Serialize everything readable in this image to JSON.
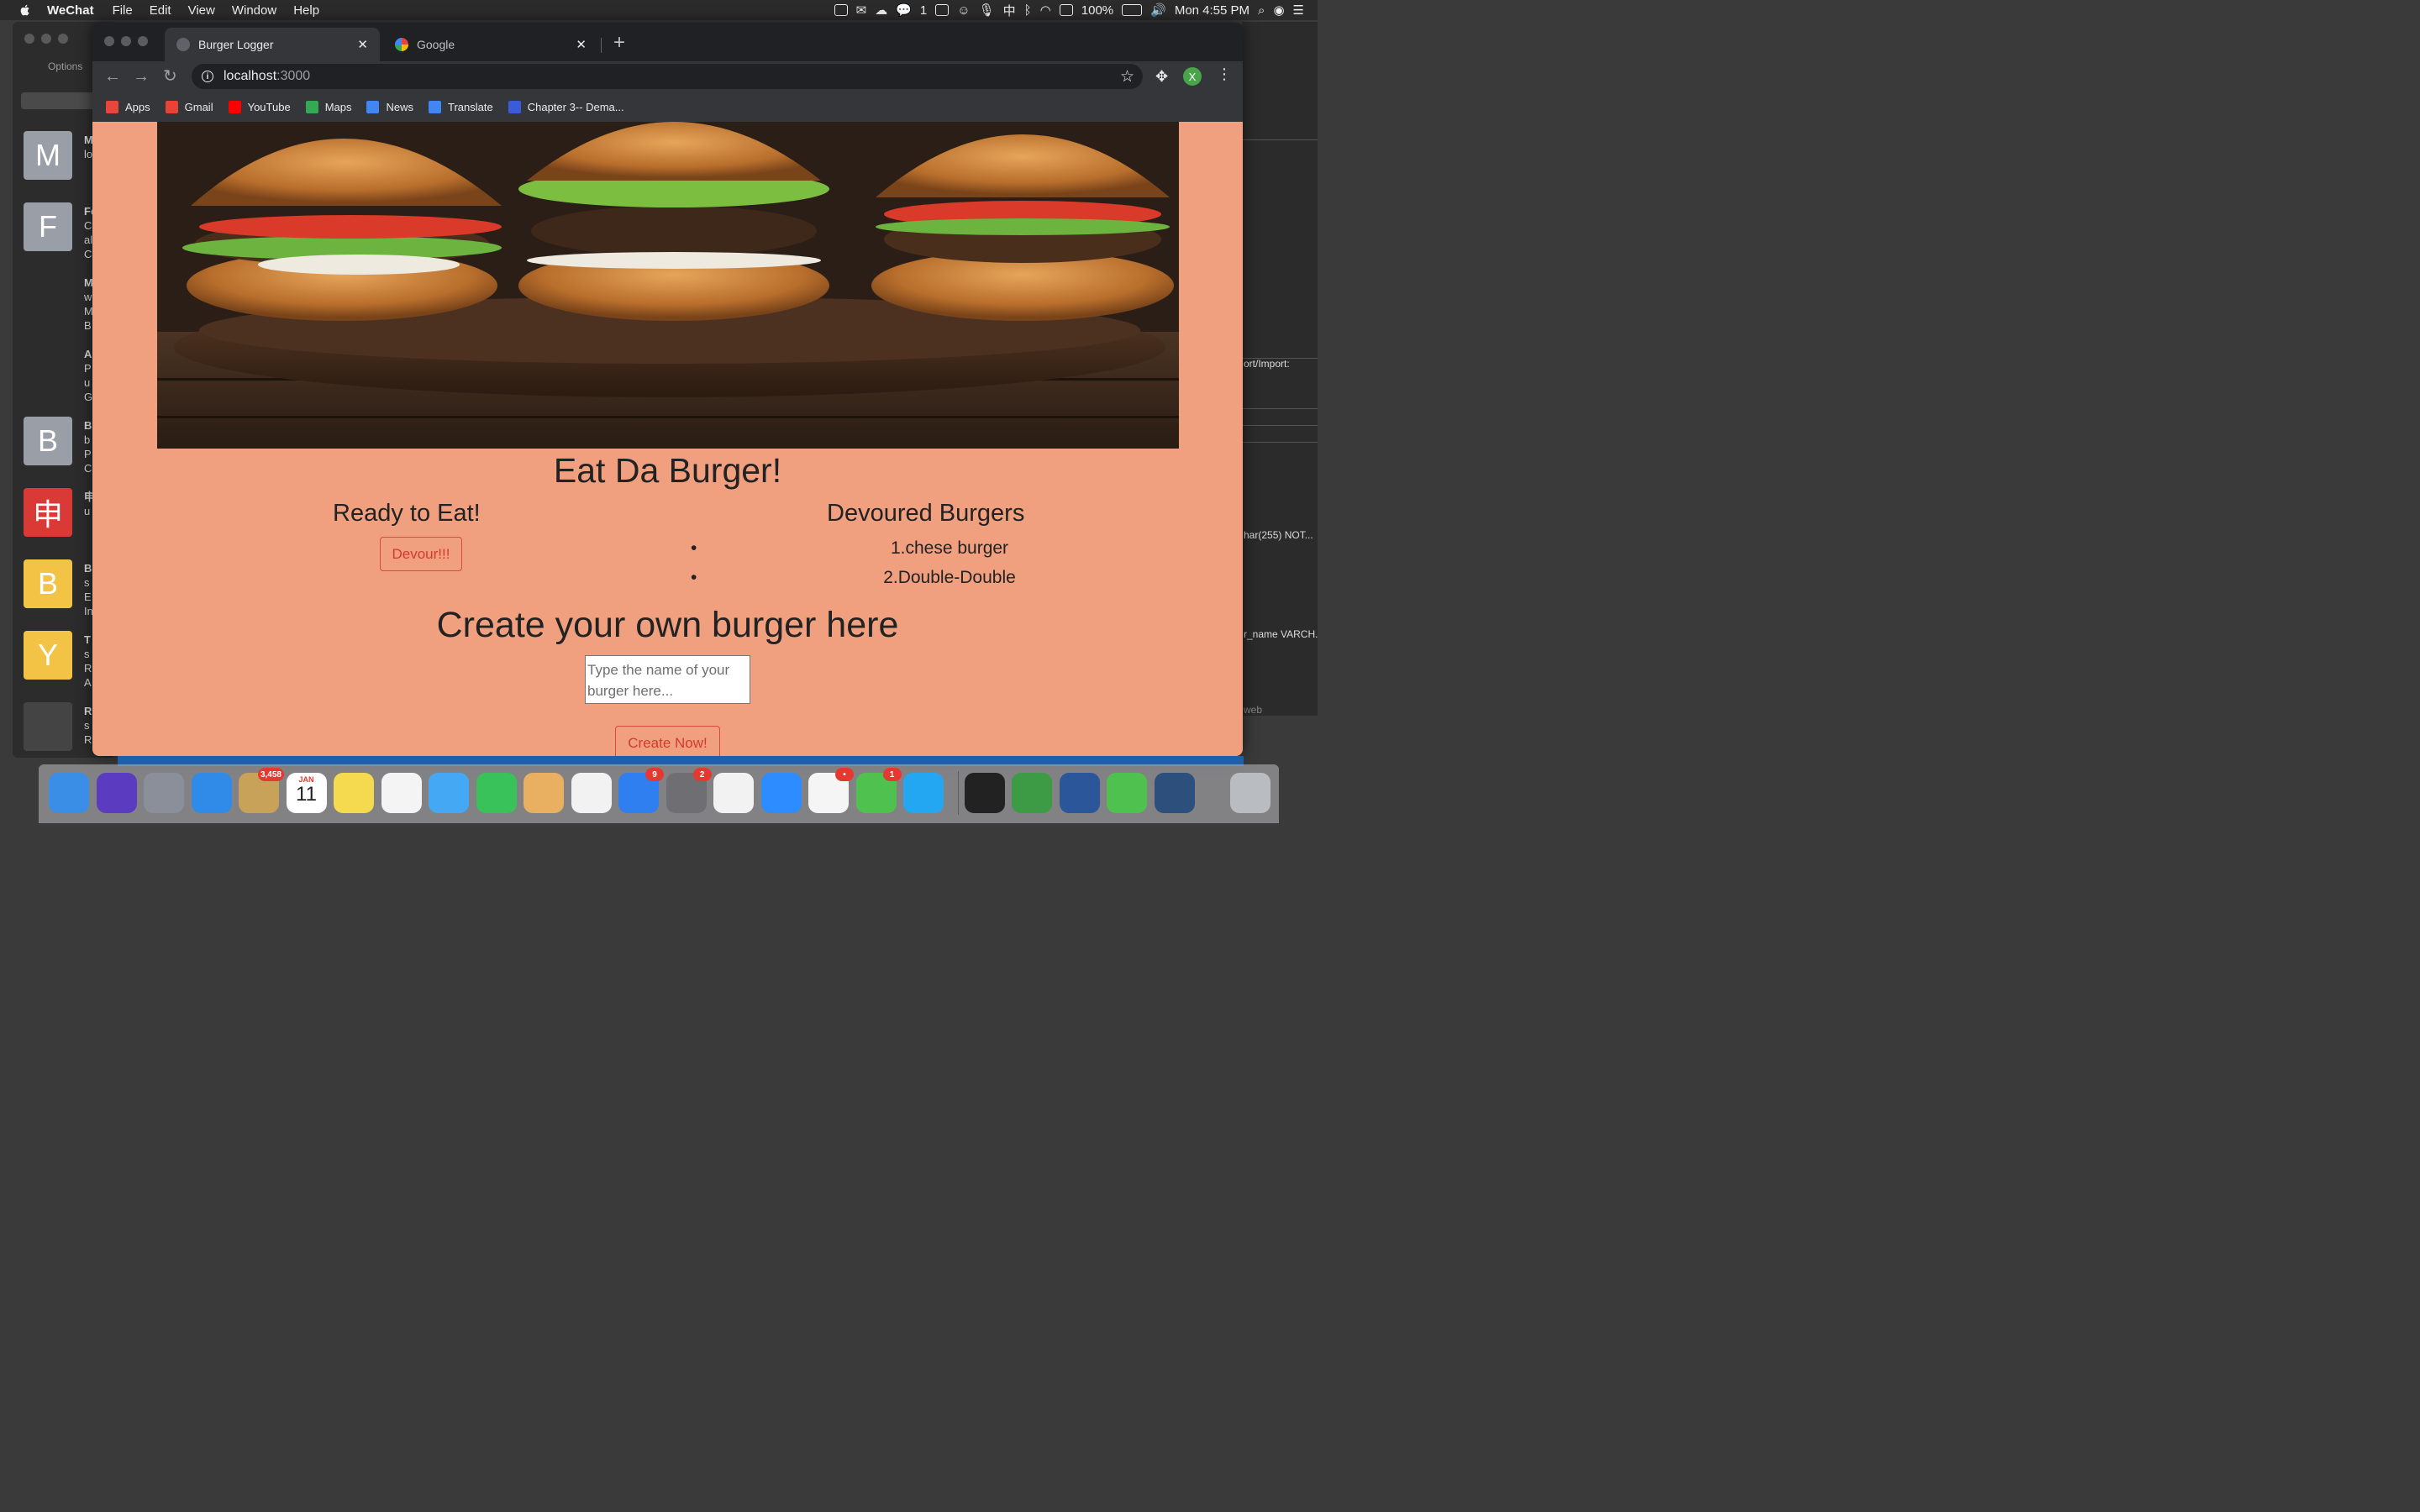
{
  "menubar": {
    "app_name": "WeChat",
    "menus": [
      "File",
      "Edit",
      "View",
      "Window",
      "Help"
    ],
    "wechat_count": "1",
    "battery": "100%",
    "clock": "Mon 4:55 PM"
  },
  "wechat": {
    "options_label": "Options",
    "chats": [
      {
        "letter": "M",
        "color": "#9a9ea7",
        "lines": [
          "M",
          "lo"
        ]
      },
      {
        "letter": "F",
        "color": "#9a9ea7",
        "lines": [
          "Fe",
          "C",
          "al",
          "C"
        ]
      },
      {
        "letter": "",
        "color": "#2c2c2c",
        "lines": [
          "M",
          "w",
          "M",
          "B"
        ]
      },
      {
        "letter": "",
        "color": "#2c2c2c",
        "lines": [
          "A",
          "P",
          "u",
          "G"
        ]
      },
      {
        "letter": "B",
        "color": "#9a9ea7",
        "lines": [
          "B",
          "b",
          "P",
          "C"
        ]
      },
      {
        "letter": "申",
        "color": "#d93a35",
        "lines": [
          "申",
          "u"
        ]
      },
      {
        "letter": "B",
        "color": "#f3c346",
        "lines": [
          "B",
          "s",
          "E",
          "In"
        ]
      },
      {
        "letter": "Y",
        "color": "#f3c346",
        "lines": [
          "T",
          "s",
          "R",
          "A"
        ]
      },
      {
        "letter": "",
        "color": "#444",
        "lines": [
          "R",
          "s",
          "R"
        ]
      }
    ]
  },
  "bg_right": {
    "texts": [
      "ort/Import:",
      "har(255) NOT...",
      "r_name VARCH.",
      "web"
    ]
  },
  "browser": {
    "tabs": [
      {
        "title": "Burger Logger",
        "active": true
      },
      {
        "title": "Google",
        "active": false
      }
    ],
    "url_host": "localhost",
    "url_port": ":3000",
    "profile_initial": "X",
    "bookmarks": [
      {
        "label": "Apps",
        "color": "#e8453c"
      },
      {
        "label": "Gmail",
        "color": "#ea4335"
      },
      {
        "label": "YouTube",
        "color": "#ff0000"
      },
      {
        "label": "Maps",
        "color": "#34a853"
      },
      {
        "label": "News",
        "color": "#4285f4"
      },
      {
        "label": "Translate",
        "color": "#4285f4"
      },
      {
        "label": "Chapter 3-- Dema...",
        "color": "#3b5bdb"
      }
    ]
  },
  "page": {
    "title": "Eat Da Burger!",
    "ready_heading": "Ready to Eat!",
    "devour_button": "Devour!!!",
    "devoured_heading": "Devoured Burgers",
    "devoured": [
      "1.chese burger",
      "2.Double-Double"
    ],
    "create_heading": "Create your own burger here",
    "input_placeholder": "Type the name of your burger here...",
    "create_button": "Create Now!"
  },
  "dock": {
    "apps": [
      {
        "name": "finder",
        "color": "#3a8ee6",
        "badge": ""
      },
      {
        "name": "siri",
        "color": "#5b3bbf",
        "badge": ""
      },
      {
        "name": "launchpad",
        "color": "#8a8f99",
        "badge": ""
      },
      {
        "name": "safari",
        "color": "#2f8ae8",
        "badge": ""
      },
      {
        "name": "mail",
        "color": "#c9a25a",
        "badge": "3,458"
      },
      {
        "name": "calendar",
        "color": "#ffffff",
        "badge": ""
      },
      {
        "name": "notes",
        "color": "#f5d94e",
        "badge": ""
      },
      {
        "name": "reminders",
        "color": "#f4f4f4",
        "badge": ""
      },
      {
        "name": "messages",
        "color": "#45a8f5",
        "badge": ""
      },
      {
        "name": "facetime",
        "color": "#39c25a",
        "badge": ""
      },
      {
        "name": "preview",
        "color": "#e9b062",
        "badge": ""
      },
      {
        "name": "music",
        "color": "#f2f2f2",
        "badge": ""
      },
      {
        "name": "app-store",
        "color": "#2f7ff0",
        "badge": "9"
      },
      {
        "name": "system-preferences",
        "color": "#6e6e73",
        "badge": "2"
      },
      {
        "name": "chrome",
        "color": "#f2f2f2",
        "badge": ""
      },
      {
        "name": "zoom",
        "color": "#2d8cff",
        "badge": ""
      },
      {
        "name": "slack",
        "color": "#f5f5f5",
        "badge": "•"
      },
      {
        "name": "wechat-work",
        "color": "#4fc14f",
        "badge": "1"
      },
      {
        "name": "vscode",
        "color": "#23a7f2",
        "badge": ""
      },
      {
        "name": "terminal",
        "color": "#222222",
        "badge": ""
      },
      {
        "name": "cd-app",
        "color": "#3d9b45",
        "badge": ""
      },
      {
        "name": "word",
        "color": "#2b579a",
        "badge": ""
      },
      {
        "name": "wechat",
        "color": "#4fc14f",
        "badge": ""
      },
      {
        "name": "mysql-workbench",
        "color": "#2c4f7c",
        "badge": ""
      },
      {
        "name": "trash",
        "color": "#b9bdc2",
        "badge": ""
      }
    ],
    "calendar_month": "JAN",
    "calendar_day": "11"
  }
}
